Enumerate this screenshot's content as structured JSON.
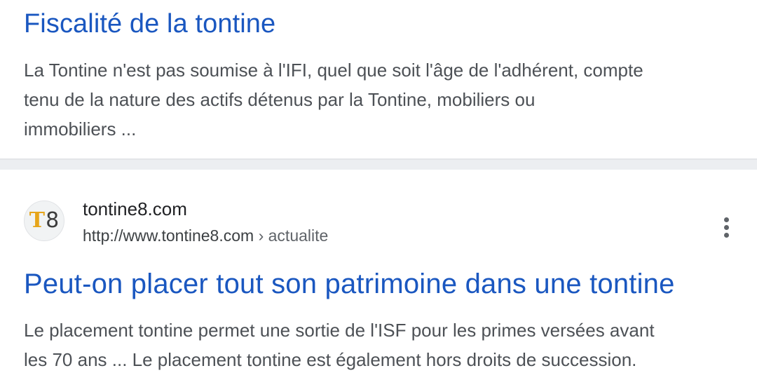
{
  "results": [
    {
      "title": "Fiscalité de la tontine",
      "snippet_lines": [
        "La Tontine n'est pas soumise à l'IFI, quel que soit l'âge de l'adhérent, compte",
        "tenu de la nature des actifs détenus par la Tontine, mobiliers ou",
        "immobiliers ..."
      ]
    },
    {
      "site_name": "tontine8.com",
      "favicon": {
        "letter_t": "T",
        "digit_8": "8",
        "accent": "#e6a51a"
      },
      "url": "http://www.tontine8.com",
      "breadcrumb_separator": "›",
      "breadcrumb": "actualite",
      "more_icon": "more-vert-icon",
      "title": "Peut-on placer tout son patrimoine dans une tontine",
      "snippet_lines": [
        "Le placement tontine permet une sortie de l'ISF pour les primes versées avant",
        "les 70 ans ... Le placement tontine est également hors droits de succession."
      ]
    }
  ],
  "colors": {
    "link": "#1a57c0",
    "snippet": "#4d5156",
    "separator": "#eceef1"
  }
}
